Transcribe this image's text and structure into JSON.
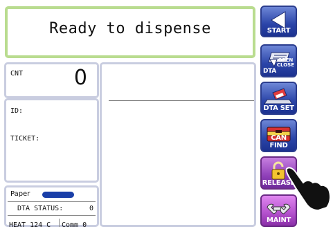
{
  "status": {
    "message": "Ready to dispense"
  },
  "counter": {
    "label": "CNT",
    "value": "0"
  },
  "info": {
    "id_label": "ID:",
    "ticket_label": "TICKET:"
  },
  "footer": {
    "paper_label": "Paper",
    "dta_status_label": "DTA STATUS:",
    "dta_status_value": "0",
    "heat_label": "HEAT 124  C",
    "comm_label": "Comm 0"
  },
  "buttons": {
    "start": {
      "label": "START",
      "icon": "triangle-left-icon"
    },
    "dta_open_close": {
      "label": "DTA",
      "sub_top": "OPEN",
      "sub_bottom": "CLOSE",
      "icon": "dta-card-icon"
    },
    "dta_set": {
      "label": "DTA SET",
      "icon": "dta-set-icon"
    },
    "can_find": {
      "label": "CAN FIND",
      "icon": "toolbox-icon"
    },
    "release": {
      "label": "RELEASE",
      "icon": "padlock-icon"
    },
    "maint": {
      "label": "MAINT",
      "icon": "wrench-icon"
    }
  },
  "colors": {
    "panel_border": "#c9cde0",
    "status_border": "#b9dc8f",
    "button_blue": "#2a44a8",
    "button_purple": "#8e3fb8",
    "paper_bar": "#1a3fa8"
  }
}
